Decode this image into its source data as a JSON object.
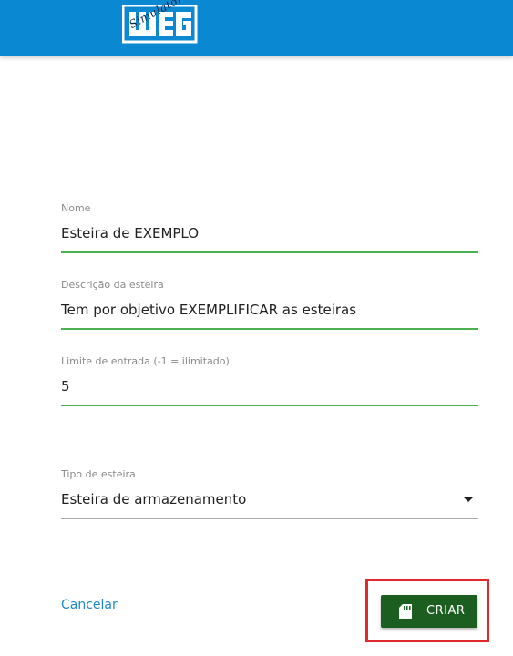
{
  "header": {
    "logo_text": "WEG",
    "logo_subtext": "Simulator",
    "brand_color": "#0a89d2"
  },
  "form": {
    "fields": [
      {
        "label": "Nome",
        "value": "Esteira de EXEMPLO"
      },
      {
        "label": "Descrição da esteira",
        "value": "Tem por objetivo EXEMPLIFICAR as esteiras"
      },
      {
        "label": "Limite de entrada (-1 = ilimitado)",
        "value": "5"
      }
    ],
    "select": {
      "label": "Tipo de esteira",
      "value": "Esteira de armazenamento",
      "icon": "arrow-drop-down-icon"
    }
  },
  "actions": {
    "cancel_label": "Cancelar",
    "create_label": "CRIAR",
    "create_icon": "sd-card-icon",
    "create_color": "#1b5e20",
    "highlight_color": "#e02a2e"
  }
}
